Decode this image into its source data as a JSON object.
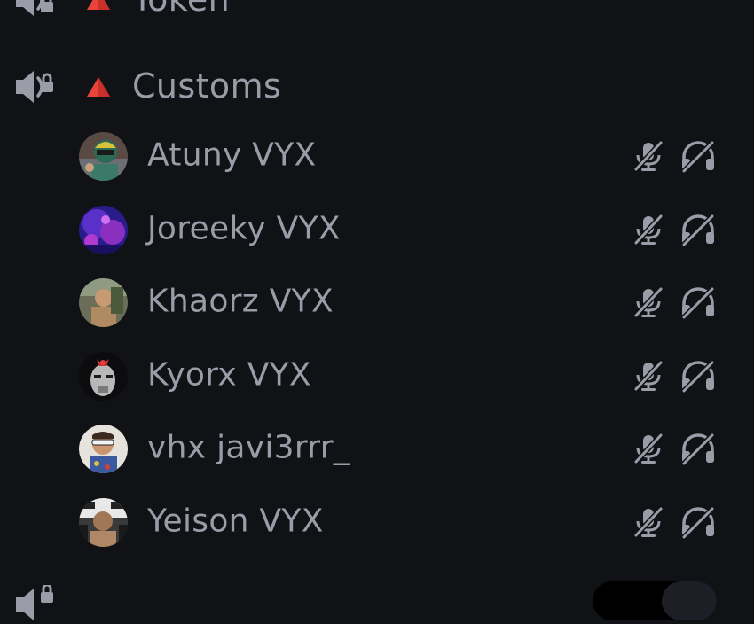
{
  "channels": [
    {
      "name": "Token",
      "icon": "voice-channel-locked-icon",
      "marker": "red-triangle-icon"
    },
    {
      "name": "Customs",
      "icon": "voice-channel-locked-icon",
      "marker": "red-triangle-icon"
    }
  ],
  "members": [
    {
      "name": "Atuny VYX",
      "avatar": "avatar-racing-helmet",
      "muted": true,
      "deafened": true
    },
    {
      "name": "Joreeky VYX",
      "avatar": "avatar-purple-crowd",
      "muted": true,
      "deafened": true
    },
    {
      "name": "Khaorz VYX",
      "avatar": "avatar-outdoor-person",
      "muted": true,
      "deafened": true
    },
    {
      "name": "Kyorx VYX",
      "avatar": "avatar-metal-mask",
      "muted": true,
      "deafened": true
    },
    {
      "name": "vhx javi3rrr_",
      "avatar": "avatar-person-sunglasses",
      "muted": true,
      "deafened": true
    },
    {
      "name": "Yeison VYX",
      "avatar": "avatar-fighter",
      "muted": true,
      "deafened": true
    }
  ],
  "colors": {
    "background": "#111216",
    "text": "#9a9ca8",
    "icon": "#9a9ca8",
    "triangle": "#e8443a"
  }
}
